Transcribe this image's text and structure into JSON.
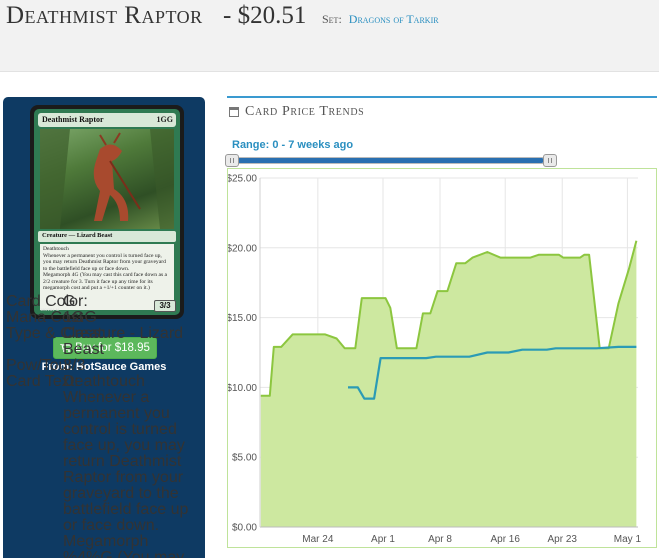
{
  "header": {
    "title": "Deathmist Raptor",
    "price": "- $20.51",
    "set_label": "Set:",
    "set_name": "Dragons of Tarkir"
  },
  "card_image": {
    "name": "Deathmist Raptor",
    "mana": "1GG",
    "type_line": "Creature — Lizard Beast",
    "rules": "Deathtouch\nWhenever a permanent you control is turned face up, you may return Deathmist Raptor from your graveyard to the battlefield face up or face down.\nMegamorph 4G (You may cast this card face down as a 2/2 creature for 3. Turn it face up any time for its megamorph cost and put a +1/+1 counter on it.)",
    "pt": "3/3",
    "collector": "180/264 M"
  },
  "buy": {
    "label": "Buy for $18.95",
    "from": "From: HotSauce Games"
  },
  "details": {
    "color_label": "Card Color:",
    "color": "G",
    "cost_label": "Mana Cost",
    "cost": "1GG",
    "type_label": "Type & Class:",
    "type": "Creature - Lizard Beast",
    "pt_label": "Pow/Tou:",
    "pt": "3/3",
    "text_label": "Card Text:",
    "text": "Deathtouch Whenever a permanent you control is turned face up, you may return Deathmist Raptor from your graveyard to the battlefield face up or face down. Megamorph %4%G (You may cast this card"
  },
  "trends": {
    "title": "Card Price Trends",
    "range": "Range: 0 - 7 weeks ago"
  },
  "colors": {
    "area_fill": "#cde8a0",
    "area_line": "#8cc63f",
    "buy_line": "#2b9bb5",
    "accent": "#3a9ad0"
  },
  "chart_data": {
    "type": "area",
    "x_ticks": [
      "Mar 24",
      "Apr 1",
      "Apr 8",
      "Apr 16",
      "Apr 23",
      "May 1"
    ],
    "x_tick_days": [
      24,
      32,
      39,
      47,
      54,
      62
    ],
    "y_ticks": [
      "$0.00",
      "$5.00",
      "$10.00",
      "$15.00",
      "$20.00",
      "$25.00"
    ],
    "ylim": [
      0,
      25
    ],
    "xlim": [
      16.9,
      63.3
    ],
    "grid": true,
    "series": [
      {
        "style": "area",
        "points": [
          [
            17,
            9.4
          ],
          [
            18.1,
            9.4
          ],
          [
            18.6,
            12.9
          ],
          [
            19.5,
            12.9
          ],
          [
            20.9,
            13.8
          ],
          [
            23.7,
            13.8
          ],
          [
            24.9,
            13.8
          ],
          [
            26.3,
            13.5
          ],
          [
            27.3,
            12.8
          ],
          [
            28.6,
            12.8
          ],
          [
            29.4,
            16.4
          ],
          [
            32.3,
            16.4
          ],
          [
            32.9,
            15.7
          ],
          [
            33.7,
            12.8
          ],
          [
            36.1,
            12.8
          ],
          [
            36.9,
            15.3
          ],
          [
            37.8,
            15.3
          ],
          [
            38.7,
            16.9
          ],
          [
            39.9,
            16.9
          ],
          [
            41,
            18.9
          ],
          [
            42.1,
            18.9
          ],
          [
            43,
            19.3
          ],
          [
            44.8,
            19.7
          ],
          [
            46.4,
            19.3
          ],
          [
            50.1,
            19.3
          ],
          [
            51.1,
            19.5
          ],
          [
            53.6,
            19.5
          ],
          [
            54.1,
            19.3
          ],
          [
            56.2,
            19.3
          ],
          [
            56.7,
            19.5
          ],
          [
            57.3,
            19.5
          ],
          [
            58.6,
            12.8
          ],
          [
            59.7,
            12.8
          ],
          [
            60.9,
            16.0
          ],
          [
            62.2,
            18.5
          ],
          [
            63.1,
            20.5
          ]
        ]
      },
      {
        "style": "line",
        "points": [
          [
            27.7,
            10
          ],
          [
            28.9,
            10
          ],
          [
            29.7,
            9.2
          ],
          [
            30.9,
            9.2
          ],
          [
            31.7,
            12.1
          ],
          [
            33.5,
            12.1
          ],
          [
            37.3,
            12.1
          ],
          [
            38.5,
            12.2
          ],
          [
            42.6,
            12.2
          ],
          [
            44.8,
            12.5
          ],
          [
            47.4,
            12.5
          ],
          [
            49.1,
            12.7
          ],
          [
            52.1,
            12.7
          ],
          [
            53.2,
            12.8
          ],
          [
            58.2,
            12.8
          ],
          [
            60.9,
            12.9
          ],
          [
            63.1,
            12.9
          ]
        ]
      }
    ]
  }
}
